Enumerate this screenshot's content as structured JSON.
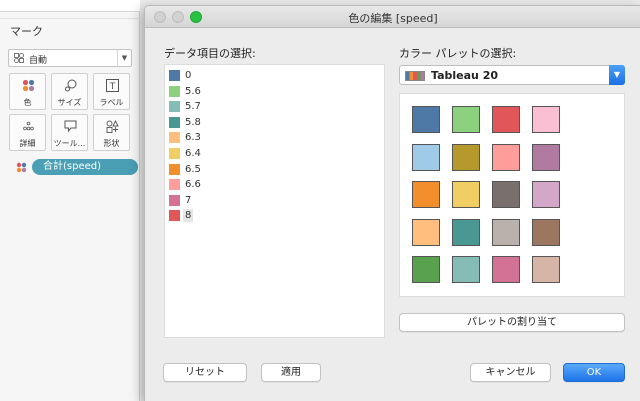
{
  "marks_panel": {
    "title": "マーク",
    "mark_type": "自動",
    "buttons": [
      {
        "label": "色",
        "icon": "color-dots-icon"
      },
      {
        "label": "サイズ",
        "icon": "size-circles-icon"
      },
      {
        "label": "ラベル",
        "icon": "label-T-icon"
      },
      {
        "label": "詳細",
        "icon": "detail-dots-icon"
      },
      {
        "label": "ツール...",
        "icon": "tooltip-speech-icon"
      },
      {
        "label": "形状",
        "icon": "shape-icon"
      }
    ],
    "color_pill": "合計(speed)"
  },
  "dialog": {
    "title": "色の編集 [speed]",
    "item_section_label": "データ項目の選択:",
    "palette_section_label": "カラー パレットの選択:",
    "items": [
      {
        "label": "0",
        "color": "#4e79a7"
      },
      {
        "label": "5.6",
        "color": "#8cd17d"
      },
      {
        "label": "5.7",
        "color": "#86bcb6"
      },
      {
        "label": "5.8",
        "color": "#499894"
      },
      {
        "label": "6.3",
        "color": "#ffbe7d"
      },
      {
        "label": "6.4",
        "color": "#f1ce63"
      },
      {
        "label": "6.5",
        "color": "#f28e2b"
      },
      {
        "label": "6.6",
        "color": "#ff9d9a"
      },
      {
        "label": "7",
        "color": "#d37295"
      },
      {
        "label": "8",
        "color": "#e15759"
      }
    ],
    "selected_item": "8",
    "palette_name": "Tableau 20",
    "palette_colors": [
      "#4e79a7",
      "#8cd17d",
      "#e15759",
      "#fabfd2",
      "#a0cbe8",
      "#b6992d",
      "#ff9d9a",
      "#b07aa1",
      "#f28e2b",
      "#f1ce63",
      "#79706e",
      "#d4a6c8",
      "#ffbe7d",
      "#499894",
      "#bab0ac",
      "#9d7660",
      "#59a14f",
      "#86bcb6",
      "#d37295",
      "#d7b5a6"
    ],
    "assign_palette_label": "パレットの割り当て",
    "reset_label": "リセット",
    "apply_label": "適用",
    "cancel_label": "キャンセル",
    "ok_label": "OK"
  }
}
